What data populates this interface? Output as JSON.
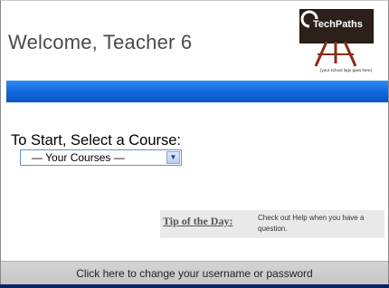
{
  "header": {
    "welcome": "Welcome, Teacher 6",
    "logo": {
      "name": "TechPaths",
      "tagline": "(your school logo goes here)",
      "icon": "easel-icon"
    }
  },
  "main": {
    "start_heading": "To Start, Select a Course:",
    "course_select": {
      "selected": "— Your Courses —",
      "arrow": "chevron-down-icon"
    }
  },
  "tip": {
    "label": "Tip of the Day:",
    "text": "Check out Help when you have a question."
  },
  "footer": {
    "link": "Click here to change your username or password"
  },
  "colors": {
    "accent_blue": "#0e66d9",
    "footer_gray": "#c8c8c8",
    "tip_bg": "#e9e9e9"
  }
}
